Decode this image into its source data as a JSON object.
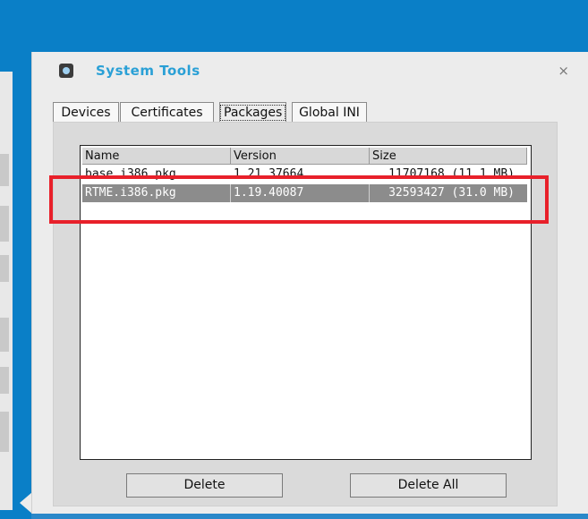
{
  "dialog": {
    "title": "System Tools",
    "close_glyph": "×",
    "icon": "system-tools-icon"
  },
  "tabs": [
    {
      "label": "Devices",
      "active": false
    },
    {
      "label": "Certificates",
      "active": false
    },
    {
      "label": "Packages",
      "active": true
    },
    {
      "label": "Global INI",
      "active": false
    }
  ],
  "table": {
    "columns": [
      "Name",
      "Version",
      "Size"
    ],
    "rows": [
      {
        "name": "base.i386.pkg",
        "version": "1.21.37664",
        "size": "11707168 (11.1 MB)",
        "selected": false
      },
      {
        "name": "RTME.i386.pkg",
        "version": "1.19.40087",
        "size": "32593427 (31.0 MB)",
        "selected": true
      }
    ]
  },
  "buttons": {
    "delete": "Delete",
    "delete_all": "Delete All"
  },
  "colors": {
    "desktop": "#0a7fc7",
    "title": "#2aa0d6",
    "selection": "#8c8c8c",
    "annotation": "#e8202a"
  }
}
